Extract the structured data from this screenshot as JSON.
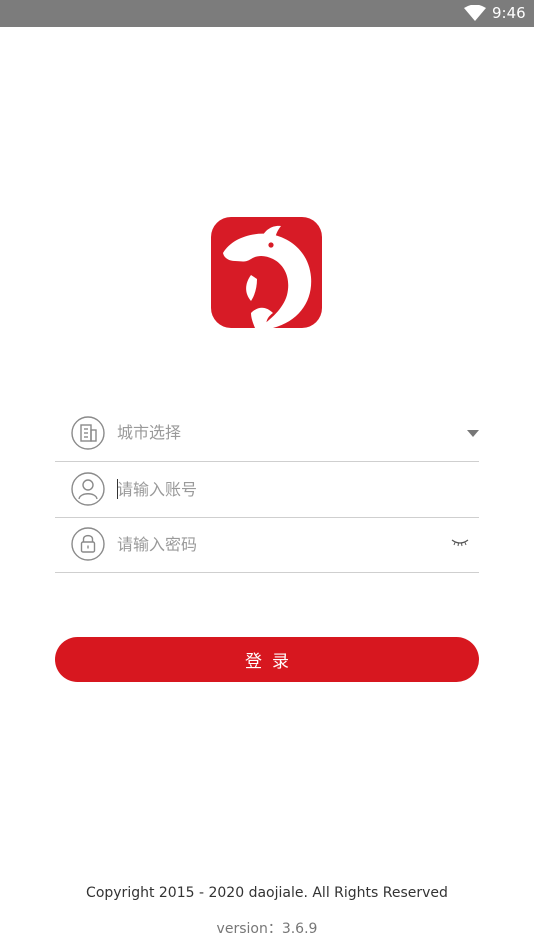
{
  "status_bar": {
    "time": "9:46",
    "wifi_icon": "wifi-icon"
  },
  "logo": {
    "icon": "dolphin-icon",
    "background_color": "#d71b26"
  },
  "form": {
    "city": {
      "icon": "building-icon",
      "label": "城市选择",
      "dropdown_icon": "triangle-down-icon"
    },
    "account": {
      "icon": "user-icon",
      "placeholder": "请输入账号",
      "value": ""
    },
    "password": {
      "icon": "lock-icon",
      "placeholder": "请输入密码",
      "value": "",
      "toggle_icon": "eye-closed-icon"
    }
  },
  "login_button": {
    "label": "登录",
    "color": "#d7171f"
  },
  "footer": {
    "copyright": "Copyright 2015 - 2020 daojiale. All Rights Reserved",
    "version": "version：3.6.9"
  }
}
